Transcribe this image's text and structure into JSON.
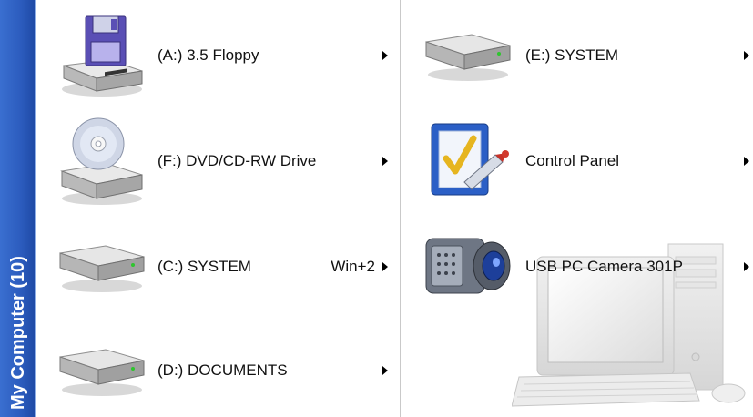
{
  "sidebar": {
    "title": "My Computer (10)"
  },
  "left_column": [
    {
      "label": "(A:) 3.5 Floppy",
      "shortcut": "",
      "icon": "floppy-drive-icon"
    },
    {
      "label": "(F:) DVD/CD-RW Drive",
      "shortcut": "",
      "icon": "dvd-drive-icon"
    },
    {
      "label": "(C:) SYSTEM",
      "shortcut": "Win+2",
      "icon": "hard-drive-icon"
    },
    {
      "label": "(D:) DOCUMENTS",
      "shortcut": "",
      "icon": "hard-drive-icon"
    }
  ],
  "right_column": [
    {
      "label": "(E:) SYSTEM",
      "icon": "hard-drive-icon"
    },
    {
      "label": "Control Panel",
      "icon": "control-panel-icon"
    },
    {
      "label": "USB PC Camera 301P",
      "icon": "camcorder-icon"
    }
  ],
  "submenu_arrow": "submenu-arrow-icon",
  "colors": {
    "sidebar": "#2c5cbe",
    "divider": "#c9c9c9"
  }
}
